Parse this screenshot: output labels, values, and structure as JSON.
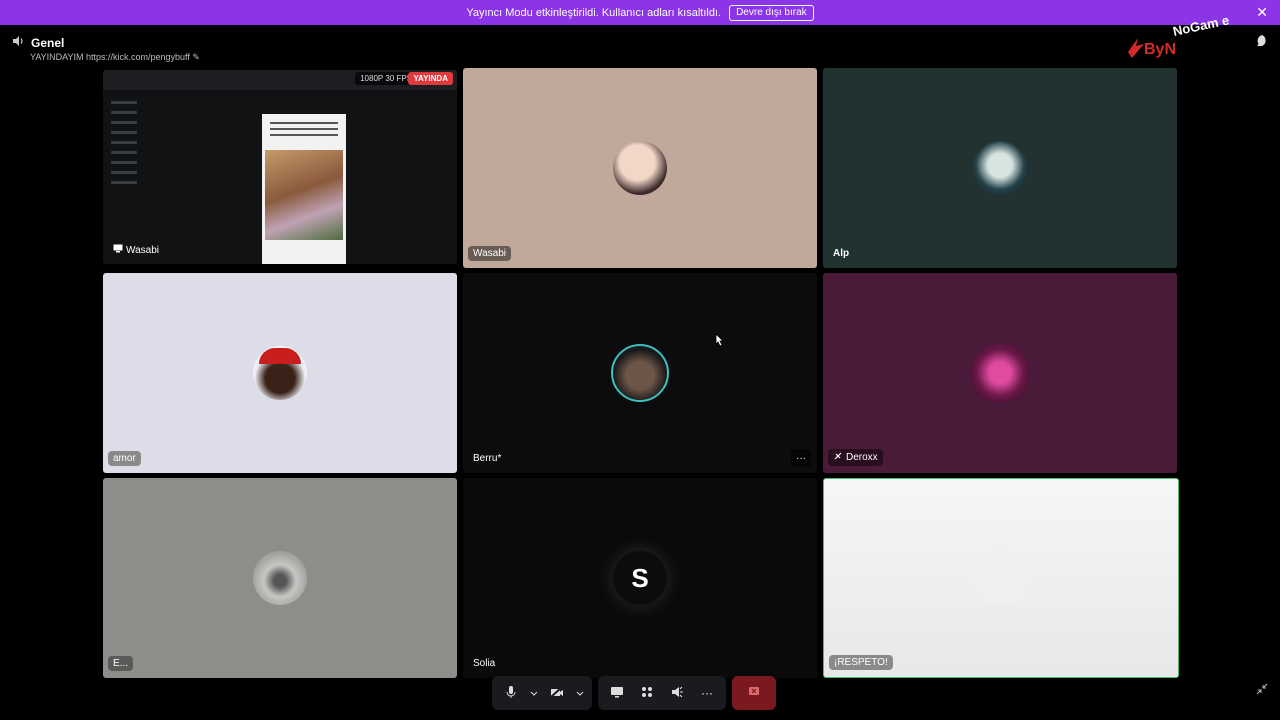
{
  "banner": {
    "text": "Yayıncı Modu etkinleştirildi. Kullanıcı adları kısaltıldı.",
    "button": "Devre dışı bırak",
    "close": "✕"
  },
  "channel": {
    "name": "Genel",
    "status": "YAYINDAYIM https://kick.com/pengybuff"
  },
  "logo": {
    "text_by": "ByN",
    "text_nogame": "NoGam e"
  },
  "stream_tile": {
    "quality": "1080P 30 FPS",
    "live_badge": "YAYINDA",
    "name": "Wasabi"
  },
  "tiles": [
    {
      "name": "Wasabi"
    },
    {
      "name": "Alp"
    },
    {
      "name": "amor"
    },
    {
      "name": "Berru*",
      "more": "···"
    },
    {
      "name": "Deroxx"
    },
    {
      "name": "E..."
    },
    {
      "name": "Solia",
      "initial": "S"
    },
    {
      "name": "¡RESPETO!"
    }
  ],
  "toolbar": {
    "more": "···"
  },
  "colors": {
    "banner": "#8b34e8",
    "hangup": "#7a1a20",
    "speaking_ring": "#3fbfbf"
  }
}
